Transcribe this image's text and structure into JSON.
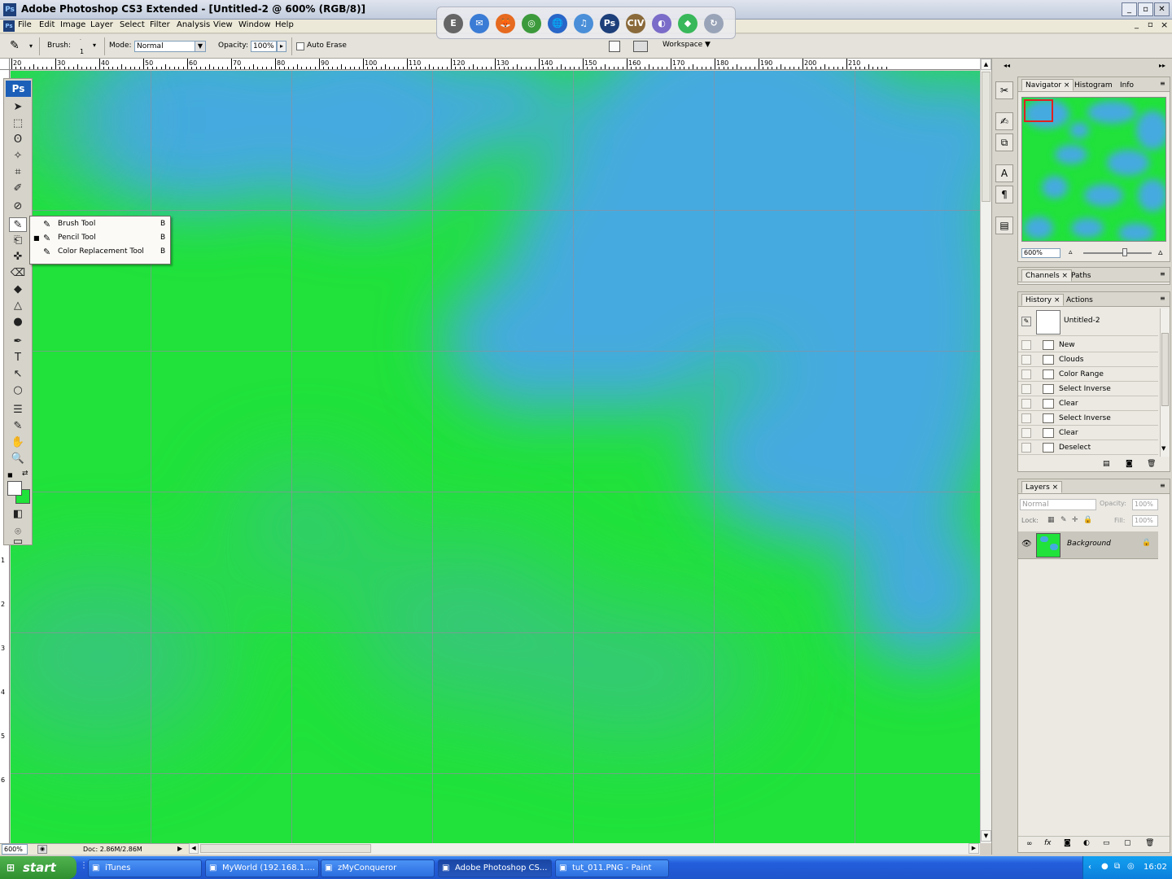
{
  "window": {
    "app_badge": "Ps",
    "title": "Adobe Photoshop CS3 Extended - [Untitled-2 @ 600% (RGB/8)]",
    "btn_minimize": "_",
    "btn_restore": "▫",
    "btn_close": "✕",
    "btn_doc_minimize": "_",
    "btn_doc_restore": "▫",
    "btn_doc_close": "×"
  },
  "quick_launch": {
    "items": [
      "E",
      "✉",
      "🦊",
      "◎",
      "🌐",
      "♫",
      "Ps",
      "CIV",
      "◐",
      "◆",
      "↻"
    ],
    "colors": [
      "#666666",
      "#3a7bd5",
      "#e66a1f",
      "#3c9a3c",
      "#2866c8",
      "#4a8fd8",
      "#1d3f7a",
      "#8a6a3a",
      "#7a6cc8",
      "#38b85a",
      "#9aa4b8"
    ]
  },
  "menu": [
    "File",
    "Edit",
    "Image",
    "Layer",
    "Select",
    "Filter",
    "Analysis",
    "View",
    "Window",
    "Help"
  ],
  "options": {
    "brush_label": "Brush:",
    "brush_size": "1",
    "mode_label": "Mode:",
    "mode_value": "Normal",
    "opacity_label": "Opacity:",
    "opacity_value": "100%",
    "auto_erase": "Auto Erase",
    "workspace": "Workspace ▼",
    "pencil_icon": "✎"
  },
  "ruler": {
    "top_labels": [
      "20",
      "30",
      "40",
      "50",
      "60",
      "70",
      "80",
      "90",
      "100",
      "110",
      "120",
      "130",
      "140",
      "150",
      "160",
      "170",
      "180",
      "190",
      "200",
      "210"
    ],
    "left_labels": [
      "1",
      "2",
      "3",
      "4",
      "5",
      "6"
    ]
  },
  "toolbox": {
    "badge": "Ps",
    "tools": [
      "➤",
      "⬚",
      "ʘ",
      "✧",
      "⌗",
      "✐",
      "⊘",
      "✎",
      "⎗",
      "✜",
      "⌫",
      "◆",
      "△",
      "●",
      "✒",
      "T",
      "↖",
      "○",
      "☰",
      "✎",
      "✋",
      "🔍",
      "◧",
      "⌾",
      "▭"
    ],
    "tool_names": [
      "move",
      "marquee",
      "lasso",
      "magic-wand",
      "crop",
      "slice",
      "healing",
      "pencil",
      "stamp",
      "history-brush",
      "eraser",
      "paint-bucket",
      "sharpen",
      "dodge",
      "pen",
      "type",
      "path-selection",
      "shape",
      "notes",
      "eyedropper",
      "hand",
      "zoom",
      "quick-mask",
      "screen-mode",
      "extra"
    ]
  },
  "flyout": {
    "items": [
      {
        "label": "Brush Tool",
        "key": "B",
        "active": false
      },
      {
        "label": "Pencil Tool",
        "key": "B",
        "active": true
      },
      {
        "label": "Color Replacement Tool",
        "key": "B",
        "active": false
      }
    ]
  },
  "status": {
    "zoom": "600%",
    "doc": "Doc: 2.86M/2.86M"
  },
  "navigator": {
    "tabs": [
      "Navigator",
      "Histogram",
      "Info"
    ],
    "zoom": "600%"
  },
  "channels": {
    "tabs": [
      "Channels",
      "Paths"
    ]
  },
  "history": {
    "tabs": [
      "History",
      "Actions"
    ],
    "snapshot": "Untitled-2",
    "items": [
      "New",
      "Clouds",
      "Color Range",
      "Select Inverse",
      "Clear",
      "Select Inverse",
      "Clear",
      "Deselect"
    ]
  },
  "layers": {
    "tabs": [
      "Layers"
    ],
    "blend": "Normal",
    "opacity_label": "Opacity:",
    "opacity": "100%",
    "lock_label": "Lock:",
    "fill_label": "Fill:",
    "fill": "100%",
    "layer_name": "Background"
  },
  "taskbar": {
    "start": "start",
    "tasks": [
      {
        "label": "iTunes",
        "active": false
      },
      {
        "label": "MyWorld (192.168.1....",
        "active": false
      },
      {
        "label": "zMyConqueror",
        "active": false
      },
      {
        "label": "Adobe Photoshop CS...",
        "active": true
      },
      {
        "label": "tut_011.PNG - Paint",
        "active": false
      }
    ],
    "clock": "16:02"
  },
  "colors": {
    "canvas_green": "#20e23a",
    "canvas_blue": "#45aadf",
    "grid": "#8f8fa0",
    "accent": "#1c5fb8"
  }
}
